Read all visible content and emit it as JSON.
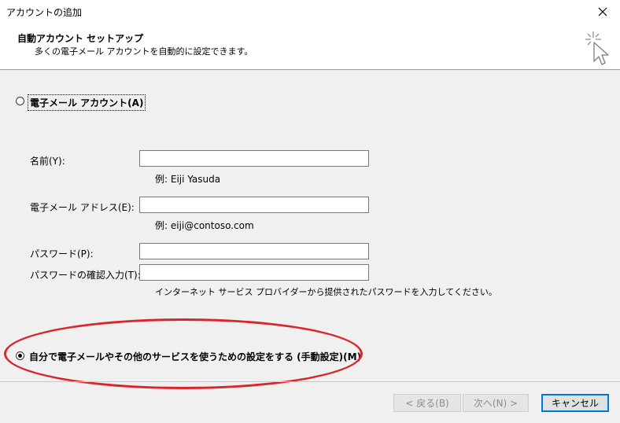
{
  "window": {
    "title": "アカウントの追加"
  },
  "header": {
    "title": "自動アカウント セットアップ",
    "subtitle": "多くの電子メール アカウントを自動的に設定できます。"
  },
  "options": {
    "email_account": {
      "label": "電子メール アカウント(A)",
      "selected": false
    },
    "manual_setup": {
      "label": "自分で電子メールやその他のサービスを使うための設定をする (手動設定)(M)",
      "selected": true
    }
  },
  "form": {
    "name": {
      "label": "名前(Y):",
      "value": "",
      "hint": "例: Eiji Yasuda"
    },
    "email": {
      "label": "電子メール アドレス(E):",
      "value": "",
      "hint": "例: eiji@contoso.com"
    },
    "password": {
      "label": "パスワード(P):",
      "value": ""
    },
    "password_confirm": {
      "label": "パスワードの確認入力(T):",
      "value": "",
      "hint": "インターネット サービス プロバイダーから提供されたパスワードを入力してください。"
    }
  },
  "buttons": {
    "back": {
      "label": "< 戻る(B)",
      "enabled": false
    },
    "next": {
      "label": "次へ(N) >",
      "enabled": false
    },
    "cancel": {
      "label": "キャンセル",
      "enabled": true
    }
  },
  "icons": {
    "close": "close-icon",
    "wizard": "cursor-sparkle-icon"
  },
  "colors": {
    "annotation": "#d9262b",
    "focus_border": "#0078d7"
  }
}
